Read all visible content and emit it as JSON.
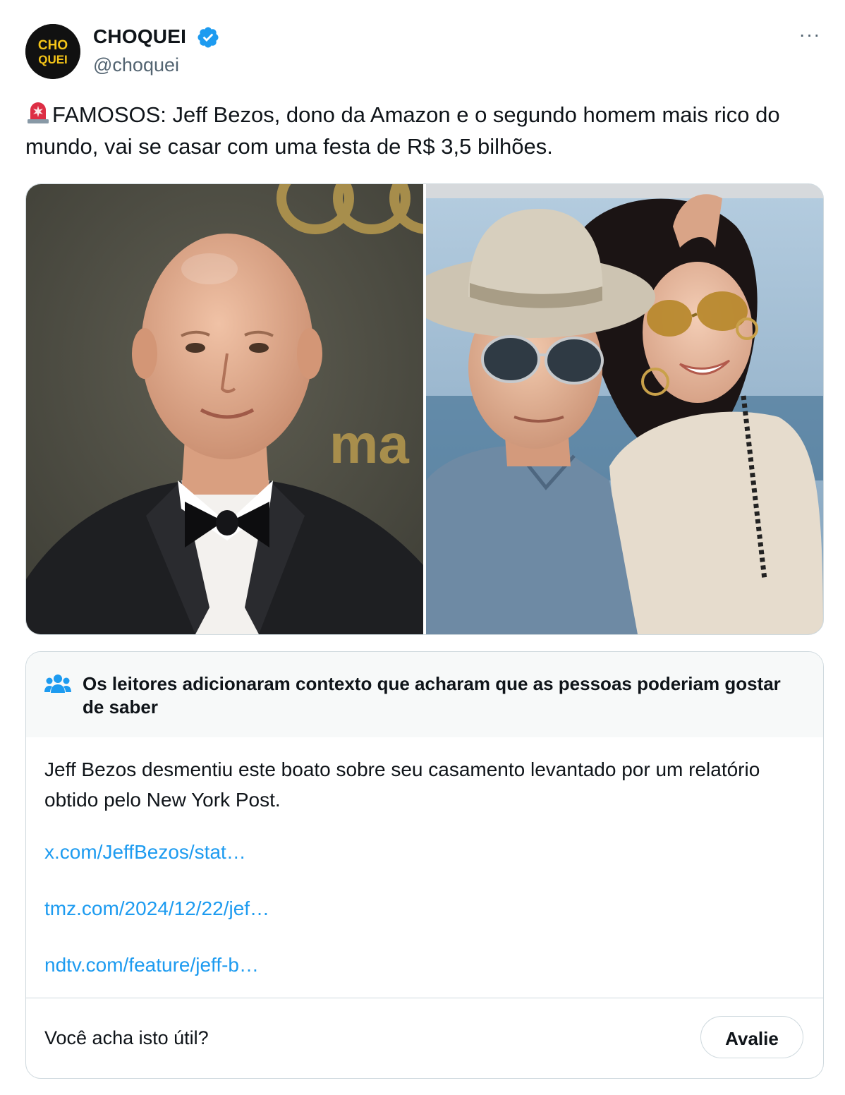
{
  "author": {
    "display_name": "CHOQUEI",
    "handle": "@choquei",
    "avatar_text": "CHOQUEI",
    "verified": true,
    "verified_color": "#1d9bf0"
  },
  "more_label": "···",
  "tweet": {
    "emoji": "siren-emoji",
    "text": "FAMOSOS: Jeff Bezos, dono da Amazon e o segundo homem mais rico do mundo, vai se casar com uma festa de R$ 3,5 bilhões."
  },
  "media": [
    {
      "kind": "photo",
      "icon": "photo-bezos-portrait"
    },
    {
      "kind": "photo",
      "icon": "photo-bezos-couple-selfie"
    }
  ],
  "community_note": {
    "icon": "people-icon",
    "title": "Os leitores adicionaram contexto que acharam que as pessoas poderiam gostar de saber",
    "body": "Jeff Bezos desmentiu este boato sobre seu casamento levantado por um relatório obtido pelo New York Post.",
    "links": [
      "x.com/JeffBezos/stat…",
      "tmz.com/2024/12/22/jef…",
      "ndtv.com/feature/jeff-b…"
    ],
    "question": "Você acha isto útil?",
    "rate_label": "Avalie",
    "link_color": "#1d9bf0"
  }
}
